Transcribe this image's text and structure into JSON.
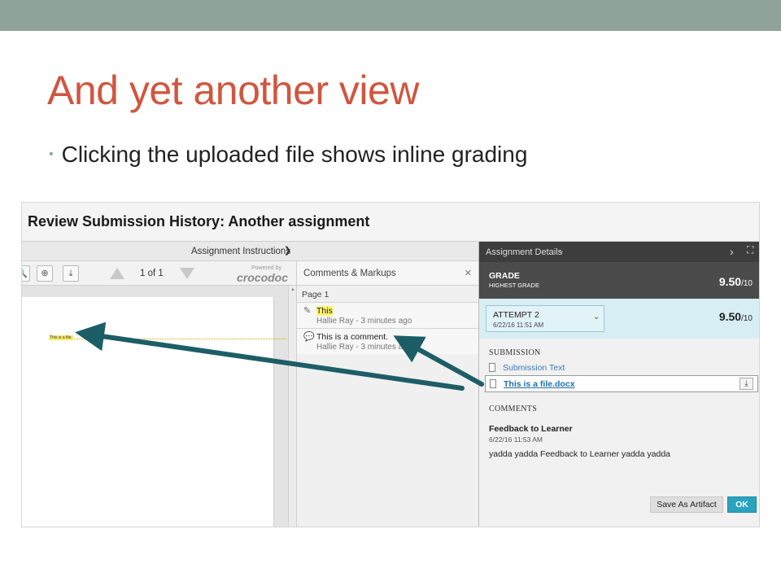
{
  "slide": {
    "title": "And yet another view",
    "bullet": "Clicking the uploaded file shows inline grading"
  },
  "screenshot": {
    "title": "Review Submission History: Another assignment",
    "instructions_label": "Assignment Instructions",
    "viewer": {
      "page_count": "1 of 1",
      "powered_by": "Powered by",
      "brand": "crocodoc",
      "file_snippet": "This is a file."
    },
    "comments": {
      "header": "Comments & Markups",
      "close": "×",
      "page_label": "Page 1",
      "items": [
        {
          "text": "This",
          "meta": "Hallie Ray - 3 minutes ago"
        },
        {
          "text": "This is a comment.",
          "meta": "Hallie Ray - 3 minutes ago"
        }
      ]
    },
    "details": {
      "header": "Assignment Details",
      "grade_label": "GRADE",
      "grade_sub": "HIGHEST GRADE",
      "grade_score": "9.50",
      "grade_den": "/10",
      "attempt_label": "ATTEMPT 2",
      "attempt_date": "6/22/16 11:51 AM",
      "attempt_score": "9.50",
      "attempt_den": "/10",
      "submission_label": "SUBMISSION",
      "submission_text": "Submission Text",
      "file_name": "This is a file.docx",
      "comments_label": "COMMENTS",
      "feedback_title": "Feedback to Learner",
      "feedback_date": "6/22/16 11:53 AM",
      "feedback_text": "yadda yadda Feedback to Learner yadda yadda",
      "save_artifact": "Save As Artifact",
      "ok": "OK"
    }
  },
  "colors": {
    "topbar": "#8fa39a",
    "title": "#d0563f",
    "arrow": "#1d5e66",
    "accent": "#2aa3c0"
  }
}
